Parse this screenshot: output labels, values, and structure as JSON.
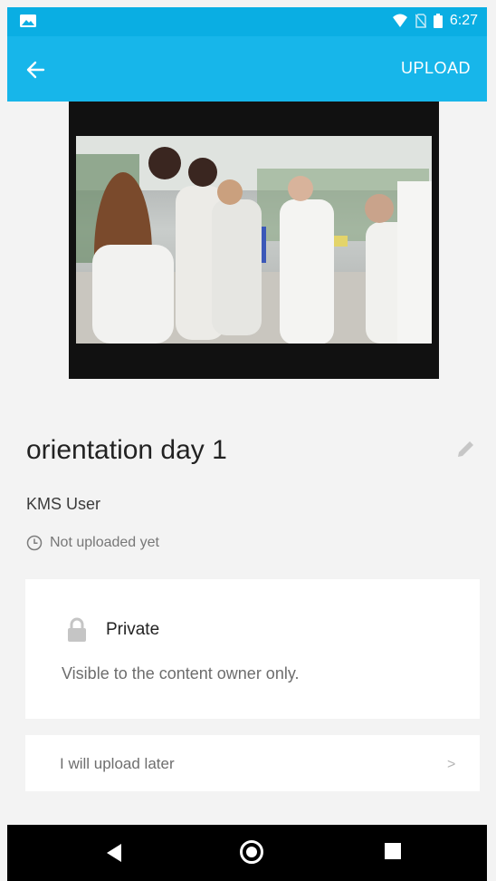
{
  "status_bar": {
    "time": "6:27"
  },
  "app_bar": {
    "back_icon": "arrow-left-icon",
    "upload_label": "UPLOAD"
  },
  "media": {
    "title": "orientation day 1",
    "owner": "KMS User",
    "upload_status": "Not uploaded yet"
  },
  "privacy": {
    "label": "Private",
    "description": "Visible to the content owner only."
  },
  "later": {
    "label": "I will upload later"
  },
  "colors": {
    "accent": "#17b6ea",
    "status_bar": "#0aaee3"
  }
}
